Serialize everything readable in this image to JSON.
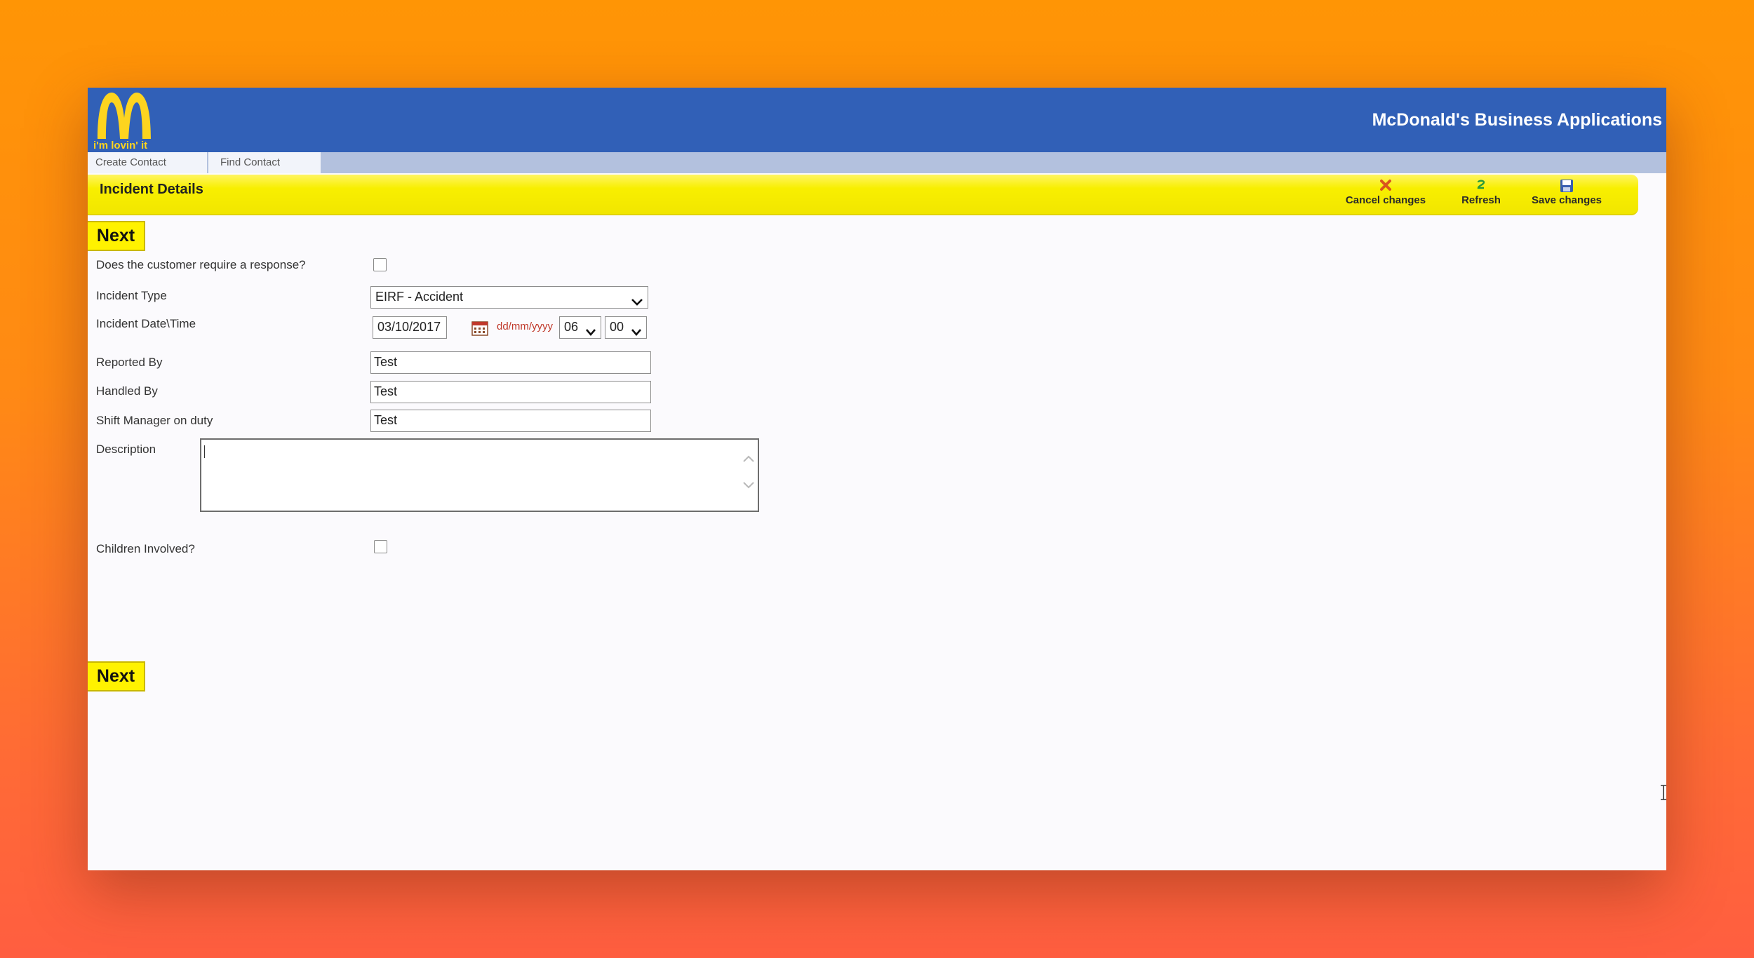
{
  "header": {
    "logo_slogan": "i'm lovin' it",
    "app_title": "McDonald's Business Applications"
  },
  "nav": {
    "tabs": [
      {
        "label": "Create Contact"
      },
      {
        "label": "Find Contact"
      }
    ]
  },
  "section": {
    "title": "Incident Details",
    "toolbar": {
      "cancel_label": "Cancel changes",
      "refresh_label": "Refresh",
      "save_label": "Save changes"
    }
  },
  "buttons": {
    "next_label": "Next"
  },
  "form": {
    "customer_response": {
      "label": "Does the customer require a response?",
      "checked": false
    },
    "incident_type": {
      "label": "Incident Type",
      "value": "EIRF - Accident"
    },
    "incident_datetime": {
      "label": "Incident Date\\Time",
      "date": "03/10/2017",
      "format_hint": "dd/mm/yyyy",
      "hour": "06",
      "minute": "00"
    },
    "reported_by": {
      "label": "Reported By",
      "value": "Test"
    },
    "handled_by": {
      "label": "Handled By",
      "value": "Test"
    },
    "shift_manager": {
      "label": "Shift Manager on duty",
      "value": "Test"
    },
    "description": {
      "label": "Description",
      "value": ""
    },
    "children_involved": {
      "label": "Children Involved?",
      "checked": false
    }
  },
  "colors": {
    "header_blue": "#3160b7",
    "nav_bar": "#b3c1de",
    "section_yellow": "#f8ef00",
    "logo_gold": "#fdd41f",
    "date_hint_red": "#c0392b"
  },
  "icons": [
    "mcdonalds-logo-icon",
    "cancel-x-icon",
    "refresh-icon",
    "save-disk-icon",
    "calendar-icon",
    "chevron-down-icon",
    "scroll-up-icon",
    "scroll-down-icon",
    "text-cursor-icon"
  ]
}
